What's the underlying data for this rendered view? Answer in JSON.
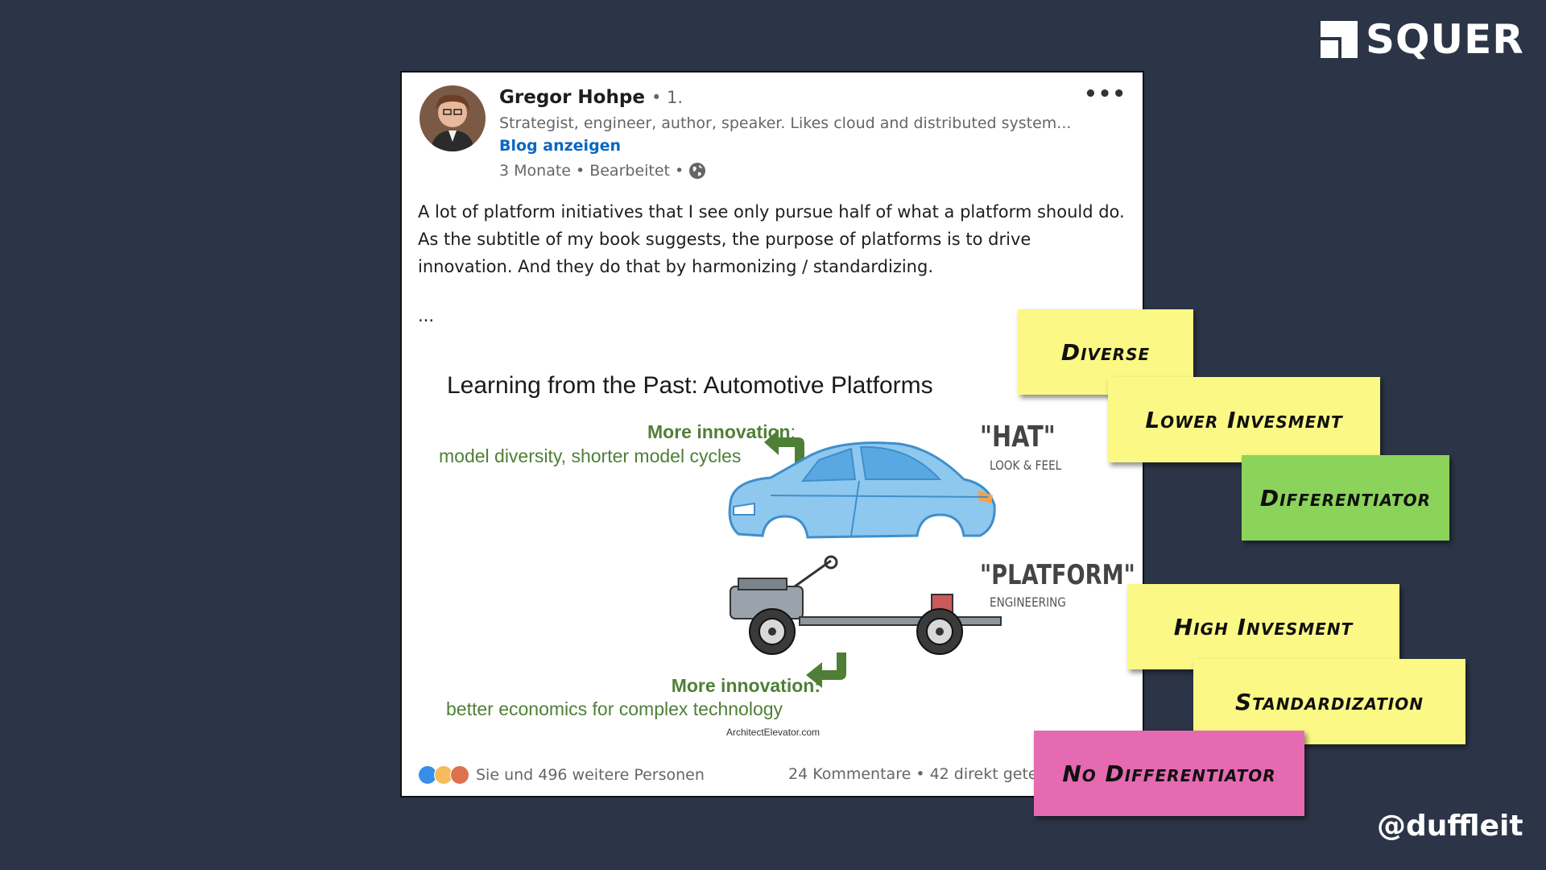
{
  "logo": {
    "text": "SQUER"
  },
  "handle": "@duffleit",
  "post": {
    "author": "Gregor Hohpe",
    "degree": "• 1.",
    "description": "Strategist, engineer, author, speaker. Likes cloud and distributed system...",
    "blog_link": "Blog anzeigen",
    "meta_time": "3 Monate",
    "meta_edited": "Bearbeitet",
    "meta_sep": "•",
    "more_icon": "more-horizontal-icon",
    "text": "A lot of platform initiatives that I see only pursue half of what a platform should do. As the subtitle of my book suggests, the purpose of platforms is to drive innovation. And they do that by harmonizing / standardizing.",
    "ellipsis": "...",
    "slide": {
      "title": "Learning from the Past: Automotive Platforms",
      "top_strong": "More innovation",
      "top_colon": ":",
      "top_text": "model diversity, shorter model cycles",
      "hat_title": "\"HAT\"",
      "hat_sub": "LOOK & FEEL",
      "platform_title": "\"PLATFORM\"",
      "platform_sub": "ENGINEERING",
      "bottom_strong": "More innovation:",
      "bottom_text": "better economics for complex technology",
      "credit": "ArchitectElevator.com"
    },
    "reactions_text": "Sie und 496 weitere Personen",
    "comments_text": "24 Kommentare • 42 direkt gete"
  },
  "stickies": [
    {
      "label": "Diverse",
      "color": "#fbf885"
    },
    {
      "label": "Lower Invesment",
      "color": "#fbf885"
    },
    {
      "label": "Differentiator",
      "color": "#8bd35a"
    },
    {
      "label": "High Invesment",
      "color": "#fbf885"
    },
    {
      "label": "Standardization",
      "color": "#fbf885"
    },
    {
      "label": "No Differentiator",
      "color": "#e56ab1"
    }
  ]
}
